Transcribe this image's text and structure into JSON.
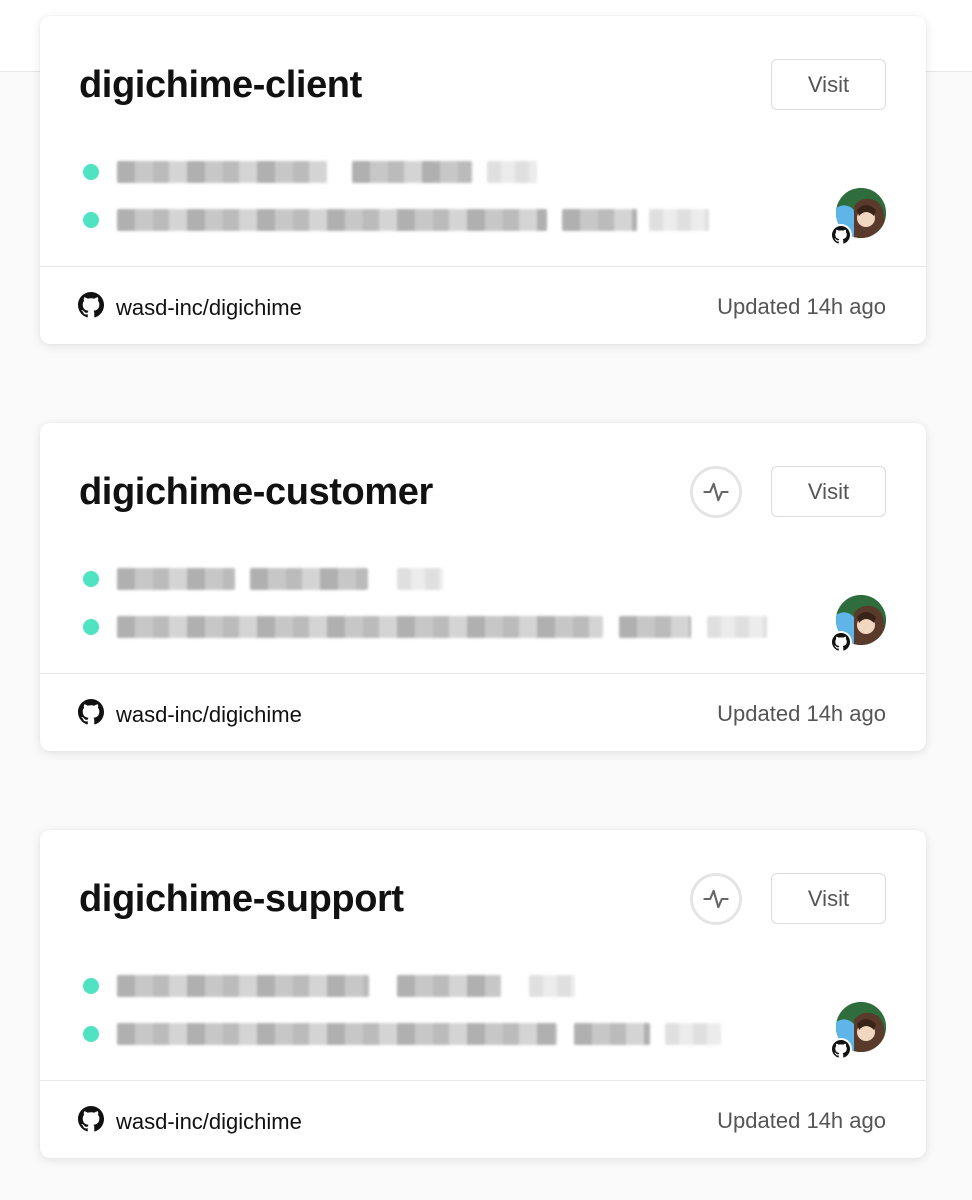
{
  "projects": [
    {
      "name": "digichime-client",
      "visit_label": "Visit",
      "has_activity": false,
      "repo": "wasd-inc/digichime",
      "updated": "Updated 14h ago",
      "status_color": "#50e3c2"
    },
    {
      "name": "digichime-customer",
      "visit_label": "Visit",
      "has_activity": true,
      "repo": "wasd-inc/digichime",
      "updated": "Updated 14h ago",
      "status_color": "#50e3c2"
    },
    {
      "name": "digichime-support",
      "visit_label": "Visit",
      "has_activity": true,
      "repo": "wasd-inc/digichime",
      "updated": "Updated 14h ago",
      "status_color": "#50e3c2"
    }
  ],
  "icons": {
    "activity": "activity-pulse-icon",
    "repo": "github-icon",
    "avatar": "user-avatar"
  }
}
